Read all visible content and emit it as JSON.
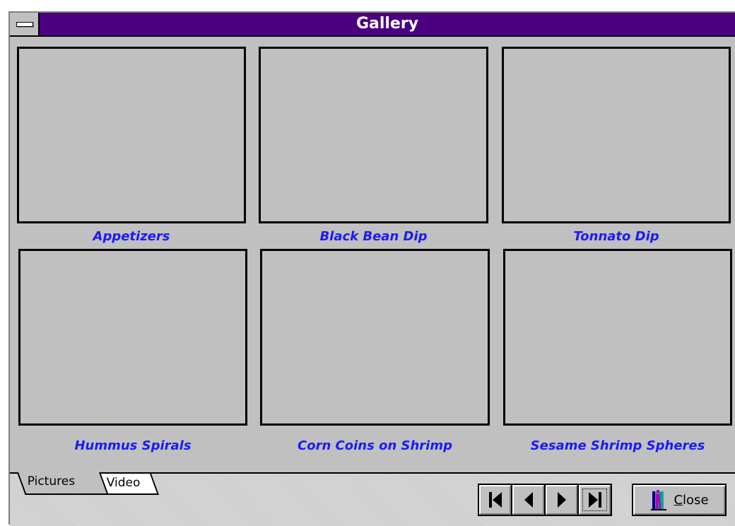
{
  "window": {
    "title": "Gallery"
  },
  "gallery": {
    "items": [
      {
        "caption": "Appetizers"
      },
      {
        "caption": "Black Bean Dip"
      },
      {
        "caption": "Tonnato Dip"
      },
      {
        "caption": "Hummus Spirals"
      },
      {
        "caption": "Corn Coins on Shrimp"
      },
      {
        "caption": "Sesame Shrimp Spheres"
      }
    ]
  },
  "tabs": [
    {
      "label": "Pictures",
      "active": true
    },
    {
      "label": "Video",
      "active": false
    }
  ],
  "nav": {
    "buttons": [
      "first-record-icon",
      "previous-record-icon",
      "next-record-icon",
      "last-record-icon"
    ]
  },
  "close_button": {
    "label": "Close",
    "icon": "exit-door-icon"
  },
  "colors": {
    "titlebar": "#4b0082",
    "caption": "#1a1aff",
    "face": "#c0c0c0"
  }
}
